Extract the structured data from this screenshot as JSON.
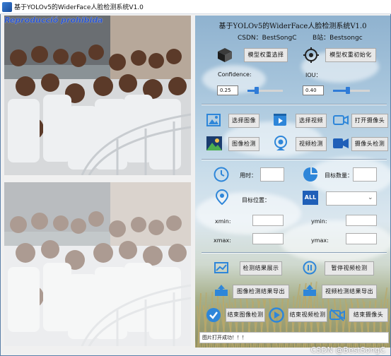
{
  "window": {
    "title": "基于YOLOv5的WiderFace人脸检测系统V1.0"
  },
  "images": {
    "watermark": "Reproducció prohibida"
  },
  "header": {
    "title": "基于YOLOv5的WiderFace人脸检测系统V1.0",
    "csdn": "CSDN：BestSongC",
    "bilibili": "B站：Bestsongc"
  },
  "model": {
    "select_label": "模型权重选择",
    "init_label": "模型权重初始化",
    "confidence_label": "Confidence:",
    "iou_label": "IOU：",
    "confidence_value": "0.25",
    "iou_value": "0.40",
    "confidence_level": 0.25,
    "iou_level": 0.4
  },
  "actions": {
    "select_image": "选择图像",
    "select_video": "选择视频",
    "open_camera": "打开摄像头",
    "detect_image": "图像检测",
    "detect_video": "视频检测",
    "detect_camera": "摄像头检测"
  },
  "info": {
    "time_label": "用时：",
    "count_label": "目标数量：",
    "position_label": "目标位置：",
    "xmin_label": "xmin:",
    "ymin_label": "ymin:",
    "xmax_label": "xmax:",
    "ymax_label": "ymax:",
    "target_select_icon_text": "ALL"
  },
  "results": {
    "show_results": "检测结果展示",
    "pause_video": "暂停视频检测",
    "export_image": "图像检测结果导出",
    "export_video": "视频检测结果导出",
    "end_image": "结束图像检测",
    "end_video": "结束视频检测",
    "end_camera": "结束摄像头"
  },
  "status": {
    "message": "图片打开成功！！！"
  },
  "footer": {
    "watermark": "CSDN @BestSongC"
  },
  "icons": [
    "cube-icon",
    "target-settings-icon",
    "image-icon",
    "video-play-icon",
    "camera-icon",
    "landscape-icon",
    "webcam-icon",
    "video-camera-icon",
    "clock-icon",
    "pie-chart-icon",
    "location-pin-icon",
    "chart-icon",
    "pause-icon",
    "export-icon",
    "check-icon",
    "stop-icon",
    "camera-off-icon"
  ]
}
